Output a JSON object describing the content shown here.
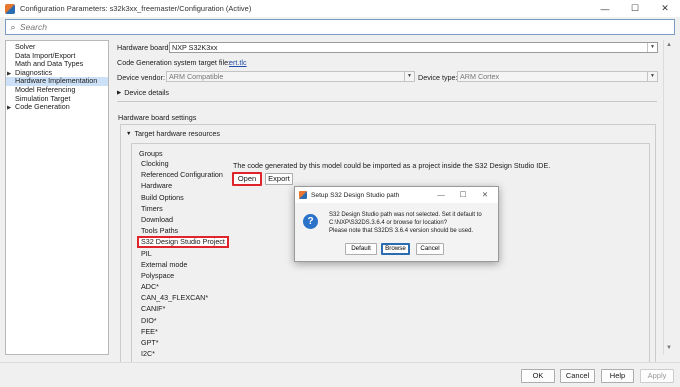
{
  "window": {
    "title": "Configuration Parameters: s32k3xx_freemaster/Configuration (Active)",
    "minimize": "—",
    "maximize": "☐",
    "close": "✕"
  },
  "search": {
    "placeholder": "Search"
  },
  "tree": {
    "items": [
      {
        "label": "Solver",
        "expandable": false
      },
      {
        "label": "Data Import/Export",
        "expandable": false
      },
      {
        "label": "Math and Data Types",
        "expandable": false
      },
      {
        "label": "Diagnostics",
        "expandable": true
      },
      {
        "label": "Hardware Implementation",
        "expandable": false,
        "selected": true
      },
      {
        "label": "Model Referencing",
        "expandable": false
      },
      {
        "label": "Simulation Target",
        "expandable": false
      },
      {
        "label": "Code Generation",
        "expandable": true
      }
    ]
  },
  "main": {
    "hardware_board_label": "Hardware board:",
    "hardware_board_value": "NXP S32K3xx",
    "codegen_label": "Code Generation system target file:",
    "codegen_link": "ert.tlc",
    "device_vendor_label": "Device vendor:",
    "device_vendor_value": "ARM Compatible",
    "device_type_label": "Device type:",
    "device_type_value": "ARM Cortex",
    "device_details": "Device details",
    "board_settings": "Hardware board settings",
    "target_resources": "Target hardware resources",
    "groups_label": "Groups",
    "groups": [
      "Clocking",
      "Referenced Configuration",
      "Hardware",
      "Build Options",
      "Timers",
      "Download",
      "Tools Paths",
      "S32 Design Studio Project",
      "PIL",
      "External mode",
      "Polyspace",
      "ADC*",
      "CAN_43_FLEXCAN*",
      "CANIF*",
      "DIO*",
      "FEE*",
      "GPT*",
      "I2C*"
    ],
    "highlighted_group_index": 7,
    "import_message": "The code generated by this model could be imported as a project inside the S32 Design Studio IDE.",
    "open_button": "Open",
    "export_button": "Export"
  },
  "dialog": {
    "title": "Setup S32 Design Studio path",
    "message_line1": "S32 Design Studio path was not selected. Set it default to",
    "message_line2": "C:\\NXP\\S32DS.3.6.4 or browse for location?",
    "message_line3": "Please note that S32DS 3.6.4 version should be used.",
    "default_button": "Default",
    "browse_button": "Browse",
    "cancel_button": "Cancel",
    "question_glyph": "?"
  },
  "footer": {
    "ok": "OK",
    "cancel": "Cancel",
    "help": "Help",
    "apply": "Apply"
  }
}
